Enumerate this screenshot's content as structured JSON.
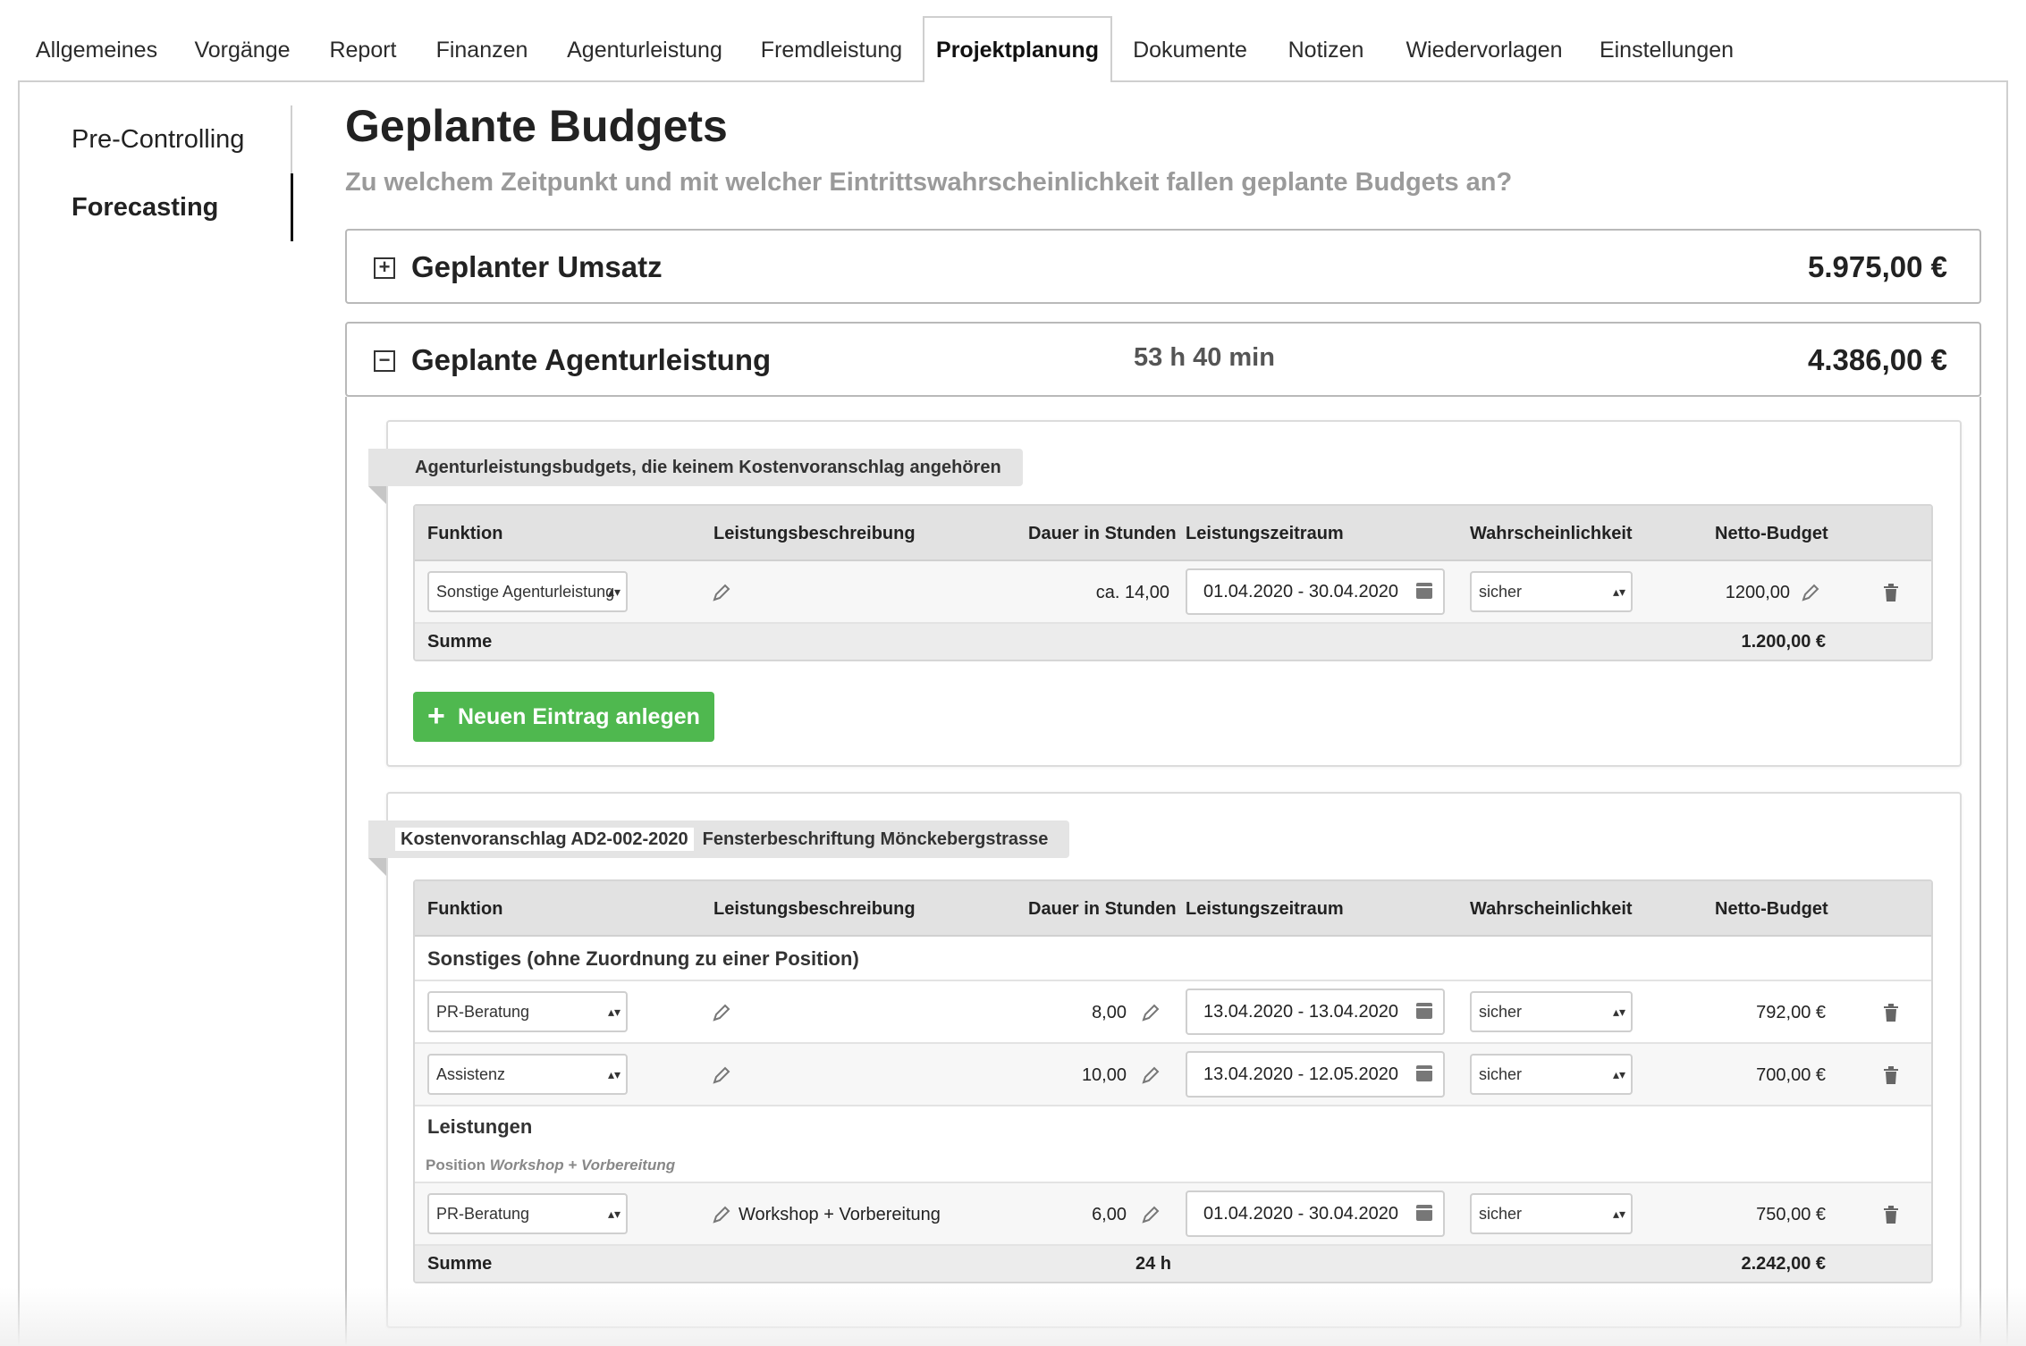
{
  "tabs": [
    {
      "label": "Allgemeines",
      "active": false
    },
    {
      "label": "Vorgänge",
      "active": false
    },
    {
      "label": "Report",
      "active": false
    },
    {
      "label": "Finanzen",
      "active": false
    },
    {
      "label": "Agenturleistung",
      "active": false
    },
    {
      "label": "Fremdleistung",
      "active": false
    },
    {
      "label": "Projektplanung",
      "active": true
    },
    {
      "label": "Dokumente",
      "active": false
    },
    {
      "label": "Notizen",
      "active": false
    },
    {
      "label": "Wiedervorlagen",
      "active": false
    },
    {
      "label": "Einstellungen",
      "active": false
    }
  ],
  "leftnav": {
    "items": [
      {
        "label": "Pre-Controlling",
        "active": false
      },
      {
        "label": "Forecasting",
        "active": true
      }
    ]
  },
  "main": {
    "title": "Geplante Budgets",
    "subtitle": "Zu welchem Zeitpunkt und mit welcher Eintrittswahrscheinlichkeit fallen geplante Budgets an?"
  },
  "panels": {
    "umsatz": {
      "toggle": "+",
      "title": "Geplanter Umsatz",
      "amount": "5.975,00 €"
    },
    "agentur": {
      "toggle": "−",
      "title": "Geplante Agenturleistung",
      "duration": "53 h 40 min",
      "amount": "4.386,00 €"
    }
  },
  "columns": {
    "funktion": "Funktion",
    "beschreibung": "Leistungsbeschreibung",
    "dauer": "Dauer in Stunden",
    "zeitraum": "Leistungszeitraum",
    "wahrscheinlichkeit": "Wahrscheinlichkeit",
    "budget": "Netto-Budget"
  },
  "card1": {
    "ribbon": "Agenturleistungsbudgets, die keinem Kostenvoranschlag angehören",
    "rows": [
      {
        "funktion": "Sonstige Agenturleistung",
        "dauer": "ca. 14,00",
        "zeitraum": "01.04.2020 - 30.04.2020",
        "wahrscheinlichkeit": "sicher",
        "budget": "1200,00"
      }
    ],
    "sum_label": "Summe",
    "sum_amount": "1.200,00 €",
    "new_button": "Neuen Eintrag anlegen"
  },
  "card2": {
    "ribbon_code": "Kostenvoranschlag AD2-002-2020",
    "ribbon_title": "Fensterbeschriftung Mönckebergstrasse",
    "group1": "Sonstiges (ohne Zuordnung zu einer Position)",
    "rows": [
      {
        "funktion": "PR-Beratung",
        "dauer": "8,00",
        "zeitraum": "13.04.2020 - 13.04.2020",
        "wahrscheinlichkeit": "sicher",
        "budget": "792,00 €"
      },
      {
        "funktion": "Assistenz",
        "dauer": "10,00",
        "zeitraum": "13.04.2020 - 12.05.2020",
        "wahrscheinlichkeit": "sicher",
        "budget": "700,00 €"
      }
    ],
    "group2": "Leistungen",
    "group2_sub_prefix": "Position ",
    "group2_sub_name": "Workshop + Vorbereitung",
    "rows2": [
      {
        "funktion": "PR-Beratung",
        "beschreibung": "Workshop + Vorbereitung",
        "dauer": "6,00",
        "zeitraum": "01.04.2020 - 30.04.2020",
        "wahrscheinlichkeit": "sicher",
        "budget": "750,00 €"
      }
    ],
    "sum_label": "Summe",
    "sum_duration": "24 h",
    "sum_amount": "2.242,00 €"
  }
}
